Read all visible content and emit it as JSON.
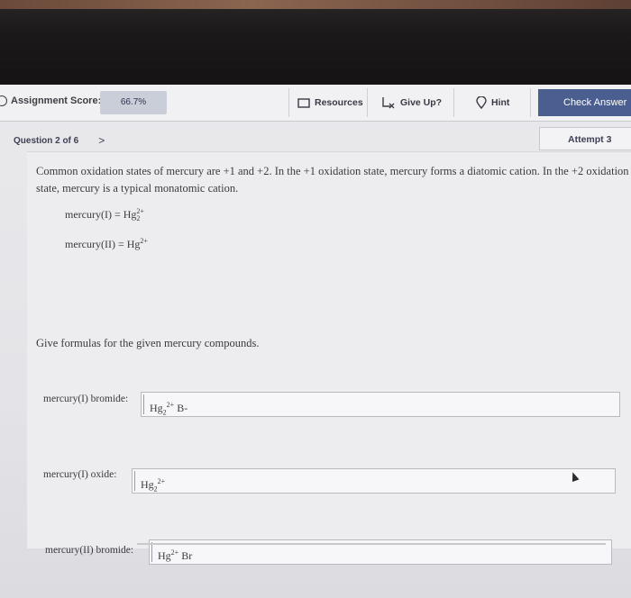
{
  "toolbar": {
    "score_label": "Assignment Score:",
    "score_value": "66.7%",
    "resources_label": "Resources",
    "give_up_label": "Give Up?",
    "hint_label": "Hint",
    "check_answer_label": "Check Answer"
  },
  "nav": {
    "question_label": "Question 2 of 6",
    "next_glyph": ">",
    "attempt_label": "Attempt 3"
  },
  "question": {
    "intro": "Common oxidation states of mercury are +1 and +2. In the +1 oxidation state, mercury forms a diatomic cation. In the +2 oxidation state, mercury is a typical monatomic cation.",
    "eq1_name": "mercury(I) = Hg",
    "eq1_sup": "2+",
    "eq1_sub": "2",
    "eq2_name": "mercury(II) = Hg",
    "eq2_sup": "2+",
    "prompt": "Give formulas for the given mercury compounds."
  },
  "answers": [
    {
      "label": "mercury(I) bromide:",
      "base": "Hg",
      "sub": "2",
      "sup": "2+",
      "tail": " B-"
    },
    {
      "label": "mercury(I) oxide:",
      "base": "Hg",
      "sub": "2",
      "sup": "2+",
      "tail": ""
    },
    {
      "label": "mercury(II) bromide:",
      "base": "Hg",
      "sub": "",
      "sup": "2+",
      "tail": " Br"
    }
  ]
}
